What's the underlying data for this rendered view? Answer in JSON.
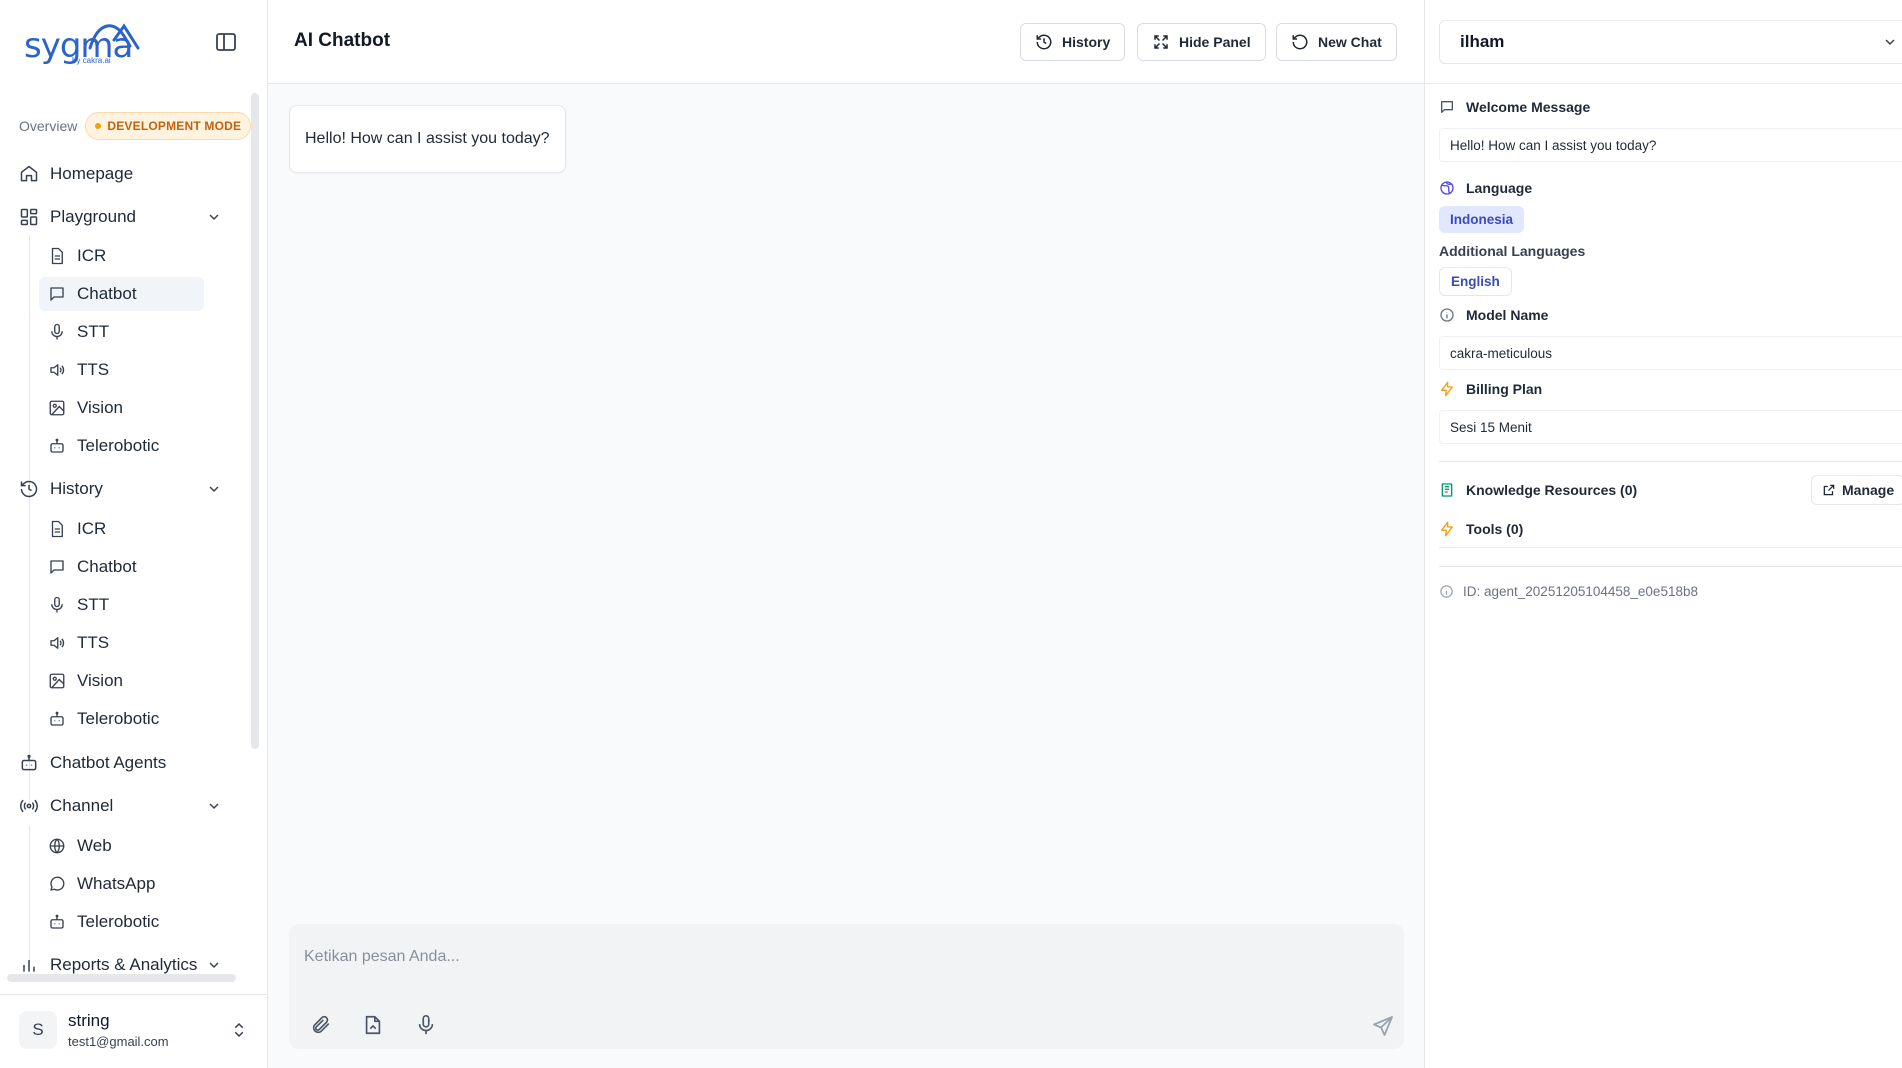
{
  "brand": {
    "name": "sygma",
    "sub": "by cakra.ai",
    "color": "#2c63c8"
  },
  "sidebar": {
    "overview_label": "Overview",
    "mode_badge": "DEVELOPMENT MODE",
    "homepage": "Homepage",
    "playground": {
      "label": "Playground",
      "items": [
        "ICR",
        "Chatbot",
        "STT",
        "TTS",
        "Vision",
        "Telerobotic"
      ]
    },
    "history": {
      "label": "History",
      "items": [
        "ICR",
        "Chatbot",
        "STT",
        "TTS",
        "Vision",
        "Telerobotic"
      ]
    },
    "chatbot_agents": "Chatbot Agents",
    "channel": {
      "label": "Channel",
      "items": [
        "Web",
        "WhatsApp",
        "Telerobotic"
      ]
    },
    "reports": "Reports & Analytics",
    "active_item": "Playground / Chatbot"
  },
  "user": {
    "initial": "S",
    "name": "string",
    "email": "test1@gmail.com"
  },
  "main": {
    "title": "AI Chatbot",
    "buttons": {
      "history": "History",
      "hide_panel": "Hide Panel",
      "new_chat": "New Chat"
    },
    "messages": [
      {
        "role": "assistant",
        "text": "Hello! How can I assist you today?"
      }
    ],
    "composer_placeholder": "Ketikan pesan Anda..."
  },
  "panel": {
    "agent_name": "ilham",
    "welcome_label": "Welcome Message",
    "welcome_value": "Hello! How can I assist you today?",
    "language_label": "Language",
    "language_value": "Indonesia",
    "additional_languages_label": "Additional Languages",
    "additional_languages": [
      "English"
    ],
    "model_label": "Model Name",
    "model_value": "cakra-meticulous",
    "billing_label": "Billing Plan",
    "billing_value": "Sesi 15 Menit",
    "knowledge_label": "Knowledge Resources (0)",
    "manage_label": "Manage",
    "tools_label": "Tools (0)",
    "agent_id": "ID: agent_20251205104458_e0e518b8"
  },
  "colors": {
    "accent": "#3b4cb8",
    "warning": "#f59e0b",
    "badge_text": "#c2620c",
    "knowledge_icon": "#059669",
    "lightning_icon": "#f59e0b",
    "language_icon": "#4f46e5"
  }
}
